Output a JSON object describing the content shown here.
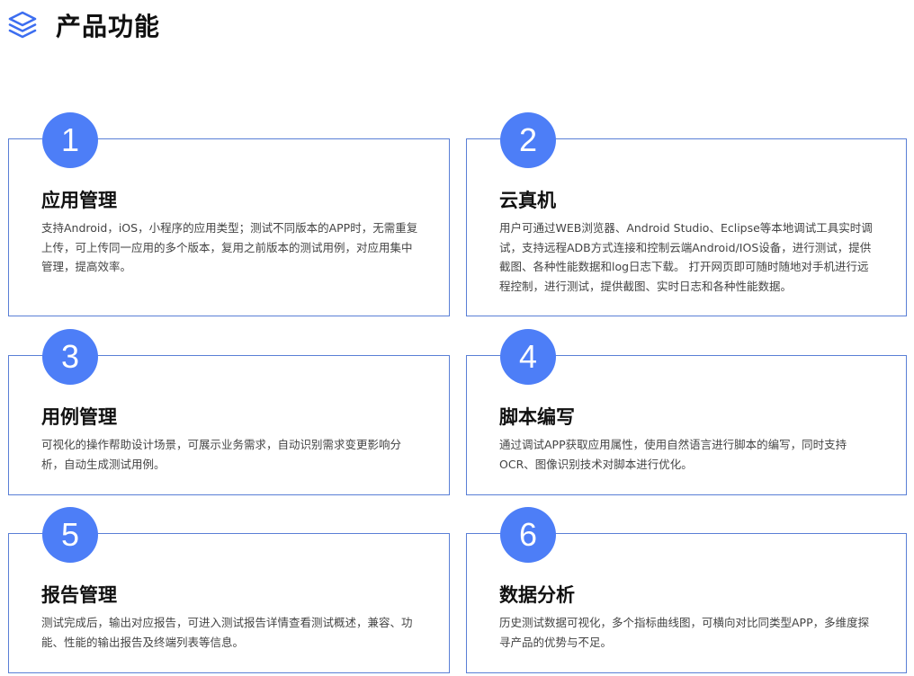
{
  "header": {
    "icon": "layers-icon",
    "title": "产品功能",
    "accent_color": "#4d7ef7",
    "border_color": "#5a7fd6"
  },
  "features": [
    {
      "number": "1",
      "title": "应用管理",
      "description": "支持Android，iOS，小程序的应用类型；测试不同版本的APP时，无需重复上传，可上传同一应用的多个版本，复用之前版本的测试用例，对应用集中管理，提高效率。"
    },
    {
      "number": "2",
      "title": "云真机",
      "description": "用户可通过WEB浏览器、Android Studio、Eclipse等本地调试工具实时调试，支持远程ADB方式连接和控制云端Android/IOS设备，进行测试，提供截图、各种性能数据和log日志下载。 打开网页即可随时随地对手机进行远程控制，进行测试，提供截图、实时日志和各种性能数据。"
    },
    {
      "number": "3",
      "title": "用例管理",
      "description": "可视化的操作帮助设计场景，可展示业务需求，自动识别需求变更影响分析，自动生成测试用例。"
    },
    {
      "number": "4",
      "title": "脚本编写",
      "description": "通过调试APP获取应用属性，使用自然语言进行脚本的编写，同时支持OCR、图像识别技术对脚本进行优化。"
    },
    {
      "number": "5",
      "title": "报告管理",
      "description": "测试完成后，输出对应报告，可进入测试报告详情查看测试概述，兼容、功能、性能的输出报告及终端列表等信息。"
    },
    {
      "number": "6",
      "title": "数据分析",
      "description": "历史测试数据可视化，多个指标曲线图，可横向对比同类型APP，多维度探寻产品的优势与不足。"
    }
  ]
}
